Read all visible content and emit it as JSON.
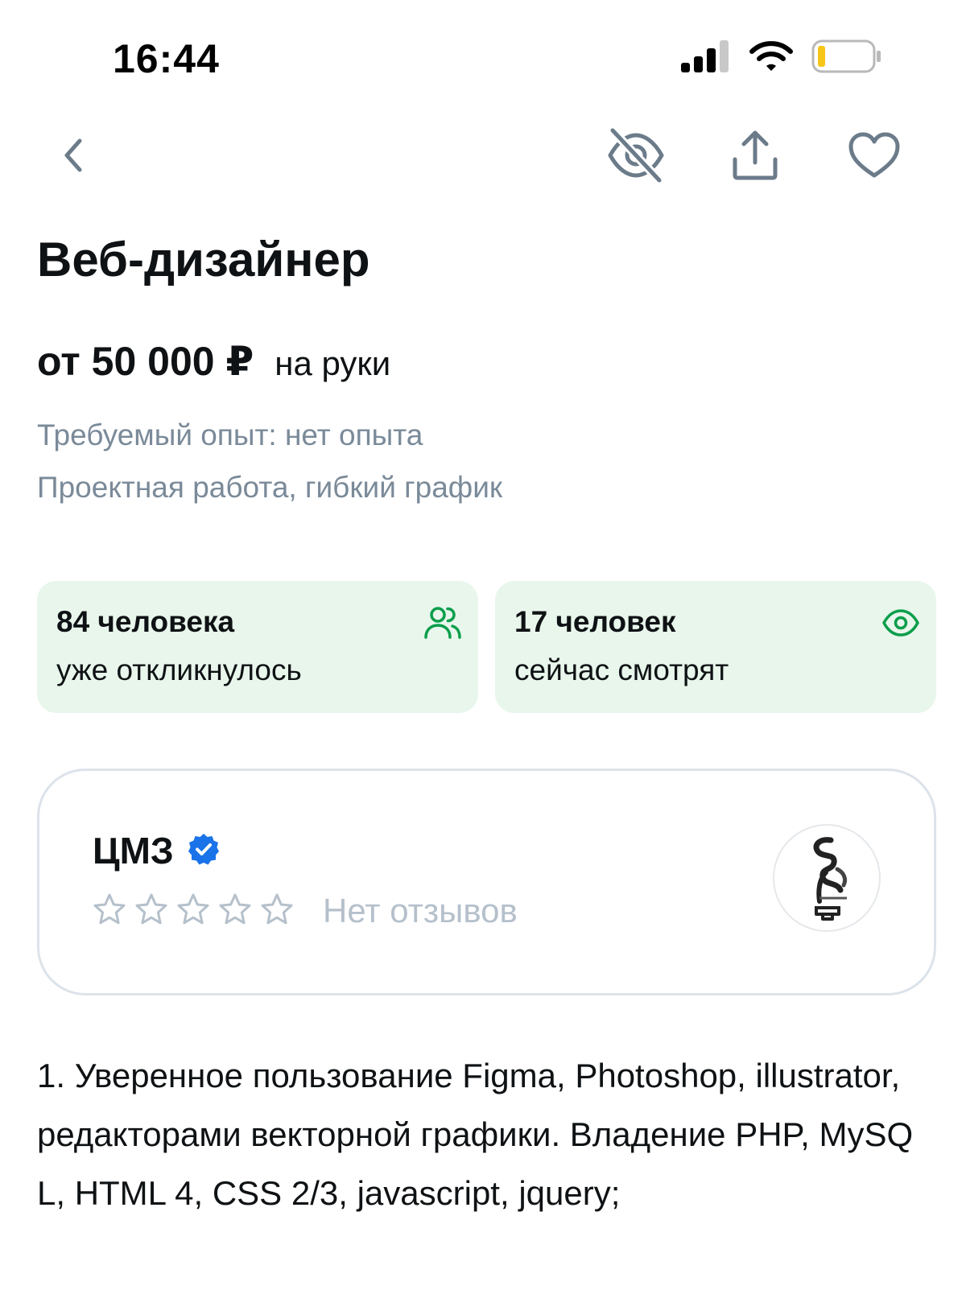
{
  "status_bar": {
    "time": "16:44",
    "icons": [
      "signal-icon",
      "wifi-icon",
      "battery-icon"
    ]
  },
  "nav": {
    "icons": [
      "back-chevron-icon",
      "hide-eye-slash-icon",
      "share-icon",
      "favorite-heart-icon"
    ]
  },
  "vacancy": {
    "title": "Веб-дизайнер",
    "salary_amount": "от 50 000 ₽",
    "salary_suffix": "на руки",
    "experience": "Требуемый опыт: нет опыта",
    "schedule": "Проектная работа, гибкий график"
  },
  "stats": {
    "responses": {
      "main": "84 человека",
      "sub": "уже откликнулось",
      "icon": "people-icon"
    },
    "viewers": {
      "main": "17 человек",
      "sub": "сейчас смотрят",
      "icon": "eye-icon"
    }
  },
  "employer": {
    "name": "ЦМЗ",
    "verified_icon": "verified-badge-icon",
    "rating_stars_filled": 0,
    "rating_stars_total": 5,
    "reviews_text": "Нет отзывов",
    "logo_icon": "company-logo"
  },
  "description": {
    "text": "1. Уверенное пользование Figma, Photoshop, illustrator, редакторами векторной графики. Владение PHP, MySQ L, HTML 4, CSS 2/3, javascript, jquery;"
  },
  "colors": {
    "accent_green": "#0a9e4a",
    "stat_bg": "#e8f6ec",
    "muted_text": "#7a8a99",
    "verified_blue": "#1a73e8",
    "star_outline": "#b5c0cb"
  }
}
